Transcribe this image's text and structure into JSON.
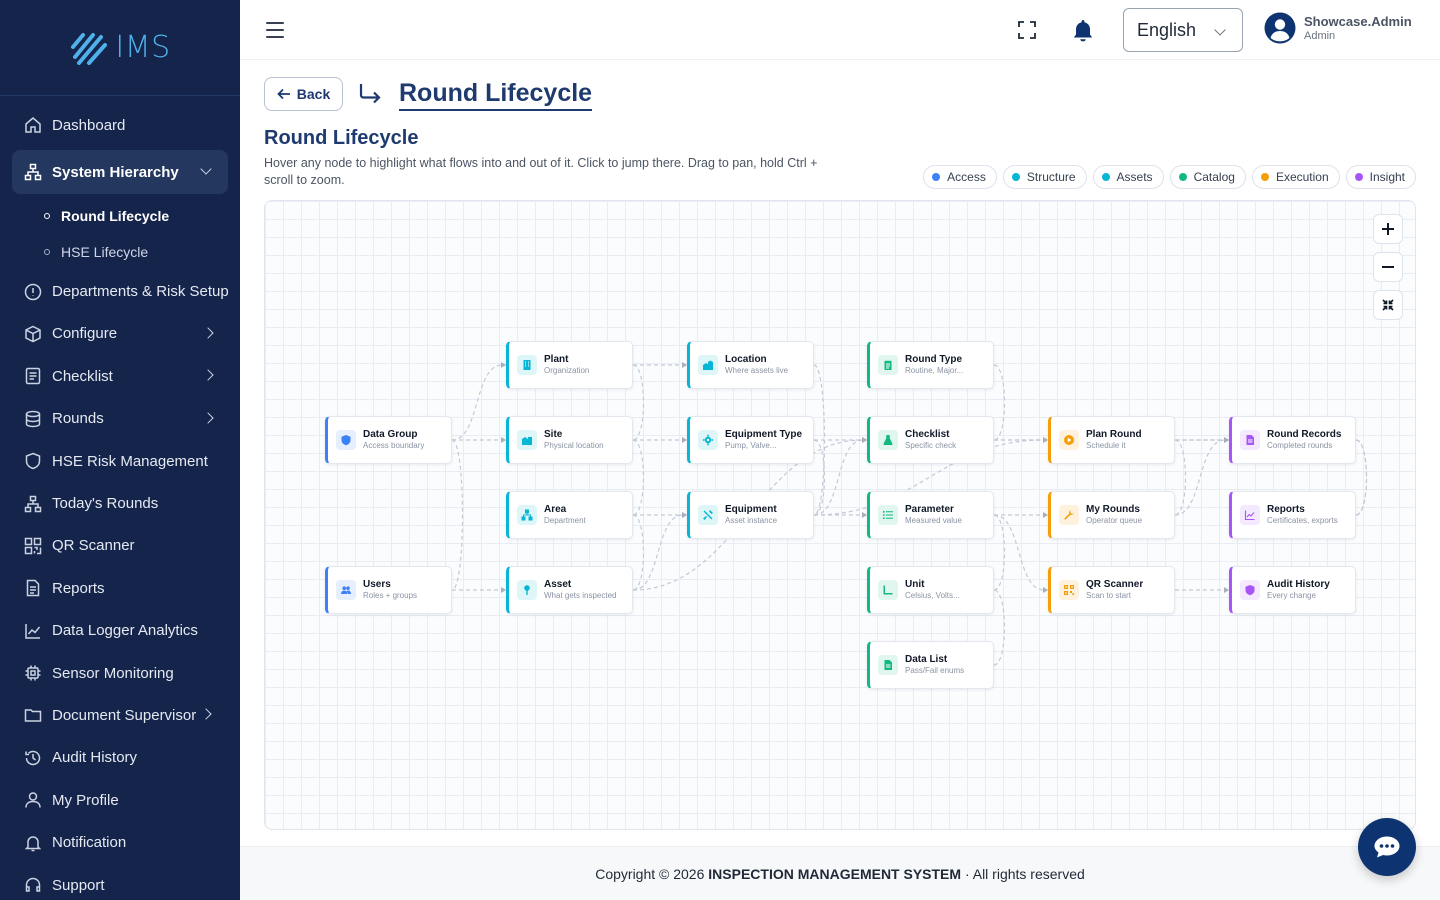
{
  "app": {
    "logo_text": "IMS"
  },
  "sidebar": {
    "items": [
      {
        "label": "Dashboard",
        "icon": "home-icon"
      },
      {
        "label": "System Hierarchy",
        "icon": "hierarchy-icon",
        "expanded": true,
        "children": [
          {
            "label": "Round Lifecycle",
            "current": true
          },
          {
            "label": "HSE Lifecycle"
          }
        ]
      },
      {
        "label": "Departments & Risk Setup",
        "icon": "info-icon"
      },
      {
        "label": "Configure",
        "icon": "cube-icon"
      },
      {
        "label": "Checklist",
        "icon": "checklist-icon"
      },
      {
        "label": "Rounds",
        "icon": "database-icon"
      },
      {
        "label": "HSE Risk Management",
        "icon": "shield-icon"
      },
      {
        "label": "Today's Rounds",
        "icon": "hierarchy-icon"
      },
      {
        "label": "QR Scanner",
        "icon": "qr-icon"
      },
      {
        "label": "Reports",
        "icon": "document-icon"
      },
      {
        "label": "Data Logger Analytics",
        "icon": "chart-icon"
      },
      {
        "label": "Sensor Monitoring",
        "icon": "chip-icon"
      },
      {
        "label": "Document Supervisor",
        "icon": "folder-icon"
      },
      {
        "label": "Audit History",
        "icon": "history-icon"
      },
      {
        "label": "My Profile",
        "icon": "user-icon"
      },
      {
        "label": "Notification",
        "icon": "bell-icon"
      },
      {
        "label": "Support",
        "icon": "headset-icon"
      }
    ]
  },
  "header": {
    "language": "English",
    "user_name": "Showcase.Admin",
    "user_role": "Admin"
  },
  "breadcrumb": {
    "back_label": "Back",
    "title": "Round Lifecycle"
  },
  "page": {
    "title": "Round Lifecycle",
    "description": "Hover any node to highlight what flows into and out of it. Click to jump there. Drag to pan, hold Ctrl + scroll to zoom."
  },
  "legend": [
    {
      "label": "Access",
      "color": "#3b82f6"
    },
    {
      "label": "Structure",
      "color": "#06b6d4"
    },
    {
      "label": "Assets",
      "color": "#06b6d4"
    },
    {
      "label": "Catalog",
      "color": "#10b981"
    },
    {
      "label": "Execution",
      "color": "#f59e0b"
    },
    {
      "label": "Insight",
      "color": "#a855f7"
    }
  ],
  "nodes": [
    {
      "id": "data-group",
      "title": "Data Group",
      "subtitle": "Access boundary",
      "color": "#3b82f6",
      "icon": "shield-icon"
    },
    {
      "id": "users",
      "title": "Users",
      "subtitle": "Roles + groups",
      "color": "#3b82f6",
      "icon": "users-icon"
    },
    {
      "id": "plant",
      "title": "Plant",
      "subtitle": "Organization",
      "color": "#06b6d4",
      "icon": "building-icon"
    },
    {
      "id": "site",
      "title": "Site",
      "subtitle": "Physical location",
      "color": "#06b6d4",
      "icon": "buildings-icon"
    },
    {
      "id": "area",
      "title": "Area",
      "subtitle": "Department",
      "color": "#06b6d4",
      "icon": "sitemap-icon"
    },
    {
      "id": "asset",
      "title": "Asset",
      "subtitle": "What gets inspected",
      "color": "#06b6d4",
      "icon": "pin-icon"
    },
    {
      "id": "location",
      "title": "Location",
      "subtitle": "Where assets live",
      "color": "#06b6d4",
      "icon": "location-icon"
    },
    {
      "id": "equipment-type",
      "title": "Equipment Type",
      "subtitle": "Pump, Valve...",
      "color": "#06b6d4",
      "icon": "gear-icon"
    },
    {
      "id": "equipment",
      "title": "Equipment",
      "subtitle": "Asset instance",
      "color": "#06b6d4",
      "icon": "tools-icon"
    },
    {
      "id": "round-type",
      "title": "Round Type",
      "subtitle": "Routine, Major...",
      "color": "#10b981",
      "icon": "clipboard-icon"
    },
    {
      "id": "checklist",
      "title": "Checklist",
      "subtitle": "Specific check",
      "color": "#10b981",
      "icon": "flask-icon"
    },
    {
      "id": "parameter",
      "title": "Parameter",
      "subtitle": "Measured value",
      "color": "#10b981",
      "icon": "list-icon"
    },
    {
      "id": "unit",
      "title": "Unit",
      "subtitle": "Celsius, Volts...",
      "color": "#10b981",
      "icon": "ruler-icon"
    },
    {
      "id": "data-list",
      "title": "Data List",
      "subtitle": "Pass/Fail enums",
      "color": "#10b981",
      "icon": "file-icon"
    },
    {
      "id": "plan-round",
      "title": "Plan Round",
      "subtitle": "Schedule it",
      "color": "#f59e0b",
      "icon": "play-icon"
    },
    {
      "id": "my-rounds",
      "title": "My Rounds",
      "subtitle": "Operator queue",
      "color": "#f59e0b",
      "icon": "wrench-icon"
    },
    {
      "id": "qr-scanner",
      "title": "QR Scanner",
      "subtitle": "Scan to start",
      "color": "#f59e0b",
      "icon": "qr-icon"
    },
    {
      "id": "round-records",
      "title": "Round Records",
      "subtitle": "Completed rounds",
      "color": "#a855f7",
      "icon": "document-icon"
    },
    {
      "id": "reports",
      "title": "Reports",
      "subtitle": "Certificates, exports",
      "color": "#a855f7",
      "icon": "chart-icon"
    },
    {
      "id": "audit-history",
      "title": "Audit History",
      "subtitle": "Every change",
      "color": "#a855f7",
      "icon": "shield-icon"
    }
  ],
  "footer": {
    "prefix": "Copyright © 2026 ",
    "company": "INSPECTION MANAGEMENT SYSTEM",
    "suffix": " · All rights reserved"
  }
}
